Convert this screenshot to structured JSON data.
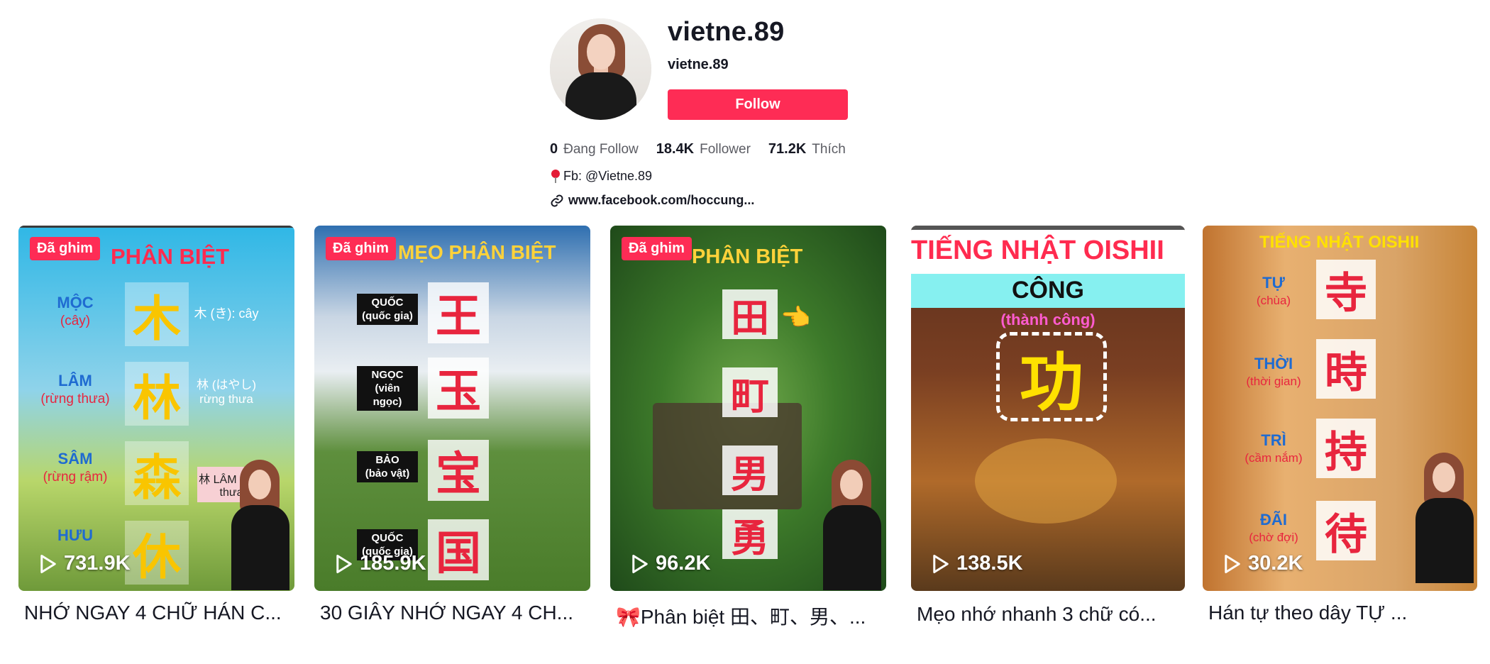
{
  "profile": {
    "username": "vietne.89",
    "nickname": "vietne.89",
    "follow_label": "Follow",
    "stats": [
      {
        "value": "0",
        "label": "Đang Follow"
      },
      {
        "value": "18.4K",
        "label": "Follower"
      },
      {
        "value": "71.2K",
        "label": "Thích"
      }
    ],
    "bio": "Fb: @Vietne.89",
    "link": "www.facebook.com/hoccung..."
  },
  "colors": {
    "accent": "#fe2c55",
    "text": "#161823",
    "muted": "#5b5c63"
  },
  "videos": [
    {
      "pinned_label": "Đã ghim",
      "views": "731.9K",
      "title": "NHỚ NGAY 4 CHỮ HÁN C...",
      "overlay": {
        "heading": "PHÂN BIỆT",
        "rows": [
          {
            "name": "MỘC",
            "meaning": "(cây)",
            "kanji": "木",
            "note": "木 (き): cây"
          },
          {
            "name": "LÂM",
            "meaning": "(rừng thưa)",
            "kanji": "林",
            "note": "林 (はやし) rừng thưa"
          },
          {
            "name": "SÂM",
            "meaning": "(rừng rậm)",
            "kanji": "森",
            "note": "林 LÂM rừng thưa"
          },
          {
            "name": "HƯU",
            "meaning": "",
            "kanji": "休",
            "note": ""
          }
        ]
      }
    },
    {
      "pinned_label": "Đã ghim",
      "views": "185.9K",
      "title": "30 GIÂY NHỚ NGAY 4 CH...",
      "overlay": {
        "heading": "MẸO PHÂN BIỆT",
        "rows": [
          {
            "name": "QUỐC",
            "meaning": "(quốc gia)",
            "kanji": "王"
          },
          {
            "name": "NGỌC",
            "meaning": "(viên ngọc)",
            "kanji": "玉"
          },
          {
            "name": "BẢO",
            "meaning": "(bảo vật)",
            "kanji": "宝"
          },
          {
            "name": "QUỐC",
            "meaning": "(quốc gia)",
            "kanji": "国"
          }
        ]
      }
    },
    {
      "pinned_label": "Đã ghim",
      "views": "96.2K",
      "title": "🎀Phân biệt 田、町、男、...",
      "overlay": {
        "heading": "PHÂN BIỆT",
        "kanji": [
          "田",
          "町",
          "男",
          "勇"
        ]
      }
    },
    {
      "views": "138.5K",
      "title": "Mẹo nhớ nhanh 3 chữ có...",
      "overlay": {
        "heading": "TIẾNG NHẬT OISHII",
        "sub": "CÔNG",
        "meaning": "(thành công)",
        "kanji": "功"
      }
    },
    {
      "views": "30.2K",
      "title": "Hán tự theo dây TỰ ...",
      "overlay": {
        "heading": "TIẾNG NHẬT OISHII",
        "rows": [
          {
            "name": "TỰ",
            "meaning": "(chùa)",
            "kanji": "寺"
          },
          {
            "name": "THỜI",
            "meaning": "(thời gian)",
            "kanji": "時"
          },
          {
            "name": "TRÌ",
            "meaning": "(cầm nắm)",
            "kanji": "持"
          },
          {
            "name": "ĐÃI",
            "meaning": "(chờ đợi)",
            "kanji": "待"
          }
        ]
      }
    }
  ]
}
